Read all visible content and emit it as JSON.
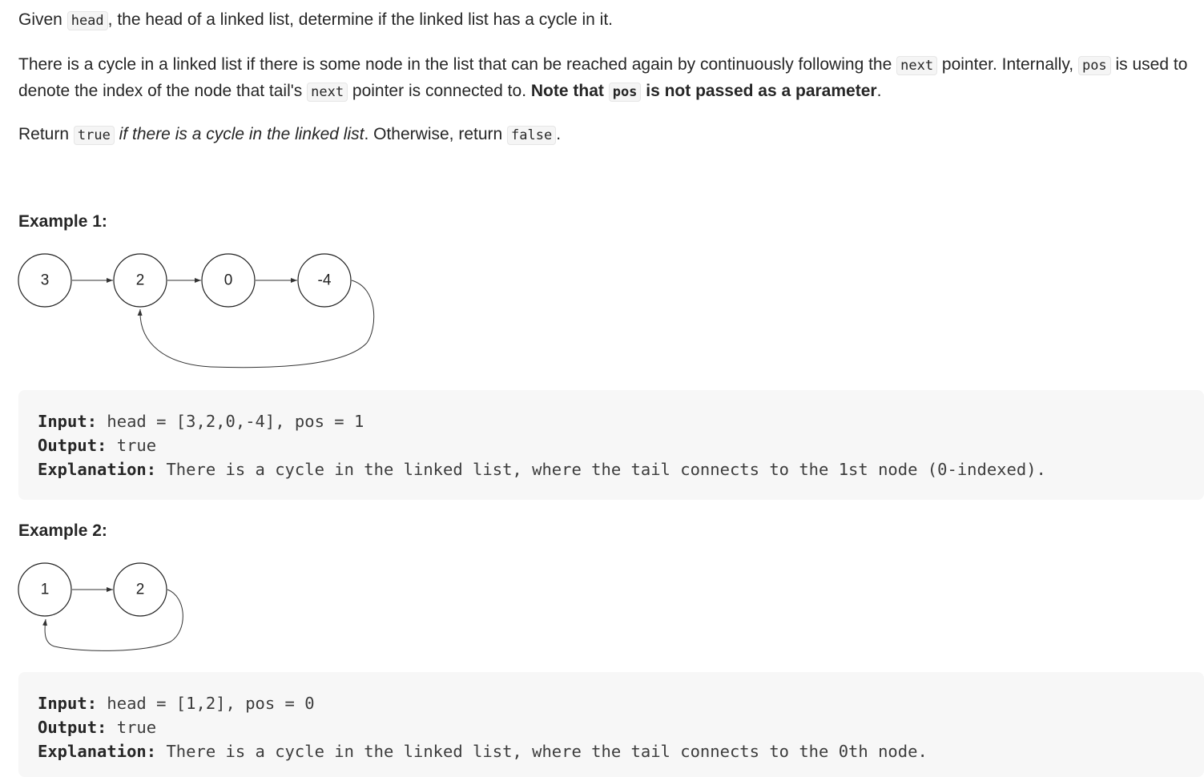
{
  "description": {
    "p1": {
      "t1": "Given ",
      "code1": "head",
      "t2": ", the head of a linked list, determine if the linked list has a cycle in it."
    },
    "p2": {
      "t1": "There is a cycle in a linked list if there is some node in the list that can be reached again by continuously following the ",
      "code1": "next",
      "t2": " pointer. Internally, ",
      "code2": "pos",
      "t3": " is used to denote the index of the node that tail's ",
      "code3": "next",
      "t4": " pointer is connected to. ",
      "bold1": "Note that ",
      "code4": "pos",
      "bold2": " is not passed as a parameter",
      "t5": "."
    },
    "p3": {
      "t1": "Return ",
      "code1": "true",
      "em1": " if there is a cycle in the linked list",
      "t2": ". Otherwise, return ",
      "code2": "false",
      "t3": "."
    }
  },
  "examples": [
    {
      "title": "Example 1:",
      "nodes": [
        "3",
        "2",
        "0",
        "-4"
      ],
      "input_label": "Input:",
      "input_value": " head = [3,2,0,-4], pos = 1",
      "output_label": "Output:",
      "output_value": " true",
      "explanation_label": "Explanation:",
      "explanation_value": " There is a cycle in the linked list, where the tail connects to the 1st node (0-indexed)."
    },
    {
      "title": "Example 2:",
      "nodes": [
        "1",
        "2"
      ],
      "input_label": "Input:",
      "input_value": " head = [1,2], pos = 0",
      "output_label": "Output:",
      "output_value": " true",
      "explanation_label": "Explanation:",
      "explanation_value": " There is a cycle in the linked list, where the tail connects to the 0th node."
    }
  ]
}
